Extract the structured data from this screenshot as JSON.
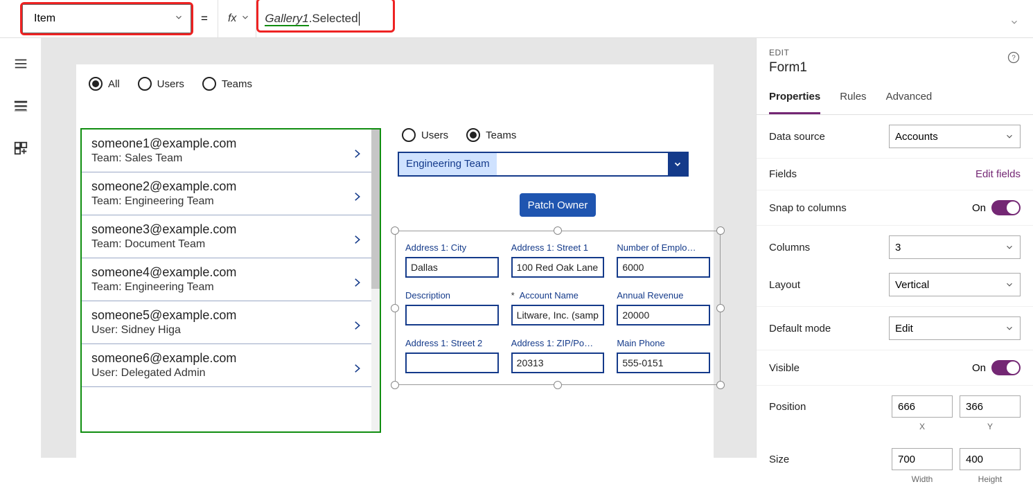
{
  "formula_bar": {
    "property": "Item",
    "fx_label": "fx",
    "formula_token1": "Gallery1",
    "formula_token2": ".Selected",
    "equals": "="
  },
  "canvas": {
    "filter_radios": [
      "All",
      "Users",
      "Teams"
    ],
    "filter_selected": 0,
    "gallery_items": [
      {
        "title": "someone1@example.com",
        "sub": "Team: Sales Team"
      },
      {
        "title": "someone2@example.com",
        "sub": "Team: Engineering Team"
      },
      {
        "title": "someone3@example.com",
        "sub": "Team: Document Team"
      },
      {
        "title": "someone4@example.com",
        "sub": "Team: Engineering Team"
      },
      {
        "title": "someone5@example.com",
        "sub": "User: Sidney Higa"
      },
      {
        "title": "someone6@example.com",
        "sub": "User: Delegated Admin"
      }
    ],
    "form": {
      "radios": [
        "Users",
        "Teams"
      ],
      "radios_selected": 1,
      "combo_value": "Engineering Team",
      "patch_button": "Patch Owner",
      "fields": [
        {
          "label": "Address 1: City",
          "value": "Dallas",
          "req": false
        },
        {
          "label": "Address 1: Street 1",
          "value": "100 Red Oak Lane",
          "req": false
        },
        {
          "label": "Number of Emplo…",
          "value": "6000",
          "req": false
        },
        {
          "label": "Description",
          "value": "",
          "req": false
        },
        {
          "label": "Account Name",
          "value": "Litware, Inc. (sample",
          "req": true
        },
        {
          "label": "Annual Revenue",
          "value": "20000",
          "req": false
        },
        {
          "label": "Address 1: Street 2",
          "value": "",
          "req": false
        },
        {
          "label": "Address 1: ZIP/Po…",
          "value": "20313",
          "req": false
        },
        {
          "label": "Main Phone",
          "value": "555-0151",
          "req": false
        }
      ]
    }
  },
  "props": {
    "edit_label": "EDIT",
    "name": "Form1",
    "tabs": [
      "Properties",
      "Rules",
      "Advanced"
    ],
    "active_tab": 0,
    "rows": {
      "data_source_label": "Data source",
      "data_source_value": "Accounts",
      "fields_label": "Fields",
      "edit_fields": "Edit fields",
      "snap_label": "Snap to columns",
      "snap_value": "On",
      "columns_label": "Columns",
      "columns_value": "3",
      "layout_label": "Layout",
      "layout_value": "Vertical",
      "default_mode_label": "Default mode",
      "default_mode_value": "Edit",
      "visible_label": "Visible",
      "visible_value": "On",
      "position_label": "Position",
      "pos_x": "666",
      "pos_y": "366",
      "pos_xl": "X",
      "pos_yl": "Y",
      "size_label": "Size",
      "size_w": "700",
      "size_h": "400",
      "size_wl": "Width",
      "size_hl": "Height"
    }
  }
}
